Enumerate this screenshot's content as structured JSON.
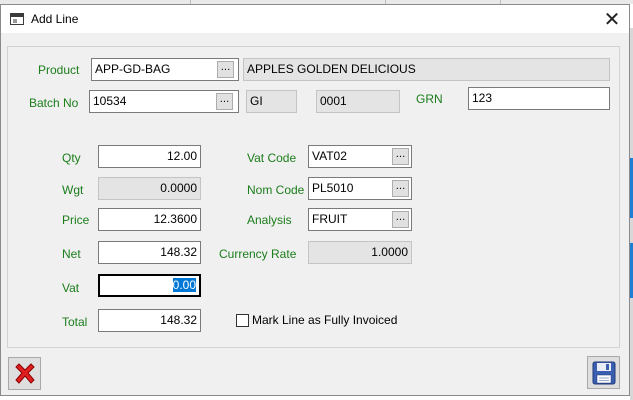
{
  "window": {
    "title": "Add Line"
  },
  "header": {
    "product_label": "Product",
    "product_code": "APP-GD-BAG",
    "product_description": "APPLES GOLDEN DELICIOUS",
    "batch_label": "Batch No",
    "batch_no": "10534",
    "batch_field2": "GI",
    "batch_field3": "0001",
    "grn_label": "GRN",
    "grn_value": "123"
  },
  "fields": {
    "qty_label": "Qty",
    "qty_value": "12.00",
    "wgt_label": "Wgt",
    "wgt_value": "0.0000",
    "price_label": "Price",
    "price_value": "12.3600",
    "net_label": "Net",
    "net_value": "148.32",
    "vat_label": "Vat",
    "vat_value": "0.00",
    "total_label": "Total",
    "total_value": "148.32",
    "vat_code_label": "Vat Code",
    "vat_code_value": "VAT02",
    "nom_code_label": "Nom Code",
    "nom_code_value": "PL5010",
    "analysis_label": "Analysis",
    "analysis_value": "FRUIT",
    "currency_rate_label": "Currency Rate",
    "currency_rate_value": "1.0000",
    "fully_invoiced_label": "Mark Line as Fully Invoiced",
    "fully_invoiced_checked": false
  },
  "buttons": {
    "ellipsis_label": "..."
  },
  "icons": {
    "window_icon": "window-icon",
    "close": "close-icon",
    "cancel": "red-x-icon",
    "save": "floppy-disk-icon"
  },
  "colors": {
    "label_green": "#1b7d1b",
    "selection_blue": "#0078d7",
    "cancel_red": "#e02020",
    "save_blue": "#3a5fb0"
  }
}
